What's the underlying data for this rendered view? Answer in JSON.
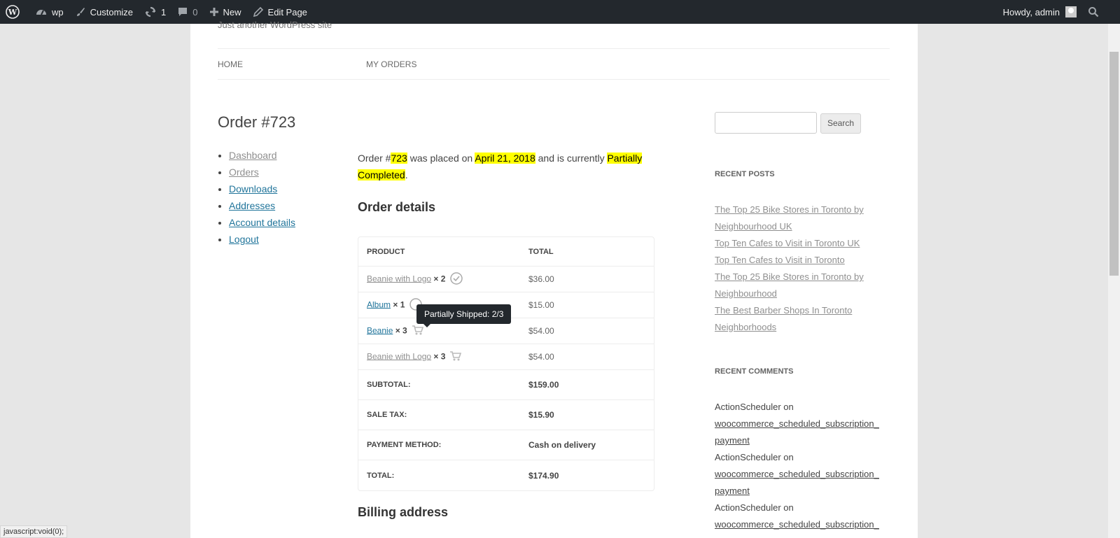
{
  "admin_bar": {
    "site_name": "wp",
    "customize": "Customize",
    "updates_count": "1",
    "comments_count": "0",
    "new_label": "New",
    "edit_page": "Edit Page",
    "howdy": "Howdy, admin"
  },
  "site": {
    "tagline": "Just another WordPress site"
  },
  "nav": {
    "home": "HOME",
    "my_orders": "MY ORDERS"
  },
  "page_title": "Order #723",
  "account_menu": [
    "Dashboard",
    "Orders",
    "Downloads",
    "Addresses",
    "Account details",
    "Logout"
  ],
  "order_summary": {
    "prefix": "Order #",
    "number": "723",
    "mid": " was placed on ",
    "date": "April 21, 2018",
    "mid2": " and is currently ",
    "status": "Partially Completed",
    "end": "."
  },
  "order_details": {
    "heading": "Order details",
    "col_product": "PRODUCT",
    "col_total": "TOTAL",
    "items": [
      {
        "name": "Beanie with Logo",
        "qty": "× 2",
        "total": "$36.00",
        "status": "shipped"
      },
      {
        "name": "Album",
        "qty": "× 1",
        "total": "$15.00",
        "status": "shipped"
      },
      {
        "name": "Beanie",
        "qty": "× 3",
        "total": "$54.00",
        "status": "partial"
      },
      {
        "name": "Beanie with Logo",
        "qty": "× 3",
        "total": "$54.00",
        "status": "unshipped"
      }
    ],
    "totals": [
      {
        "label": "SUBTOTAL:",
        "value": "$159.00"
      },
      {
        "label": "SALE TAX:",
        "value": "$15.90"
      },
      {
        "label": "PAYMENT METHOD:",
        "value": "Cash on delivery"
      },
      {
        "label": "TOTAL:",
        "value": "$174.90"
      }
    ],
    "tooltip": "Partially Shipped: 2/3"
  },
  "billing_heading": "Billing address",
  "sidebar": {
    "search_button": "Search",
    "recent_posts_title": "RECENT POSTS",
    "recent_posts": [
      "The Top 25 Bike Stores in Toronto by Neighbourhood UK",
      "Top Ten Cafes to Visit in Toronto UK",
      "Top Ten Cafes to Visit in Toronto",
      "The Top 25 Bike Stores in Toronto by Neighbourhood",
      "The Best Barber Shops In Toronto Neighborhoods"
    ],
    "recent_comments_title": "RECENT COMMENTS",
    "comment_author": "ActionScheduler",
    "comment_on": " on",
    "comment_link": "woocommerce_scheduled_subscription_ payment"
  },
  "status_bar": "javascript:void(0);"
}
